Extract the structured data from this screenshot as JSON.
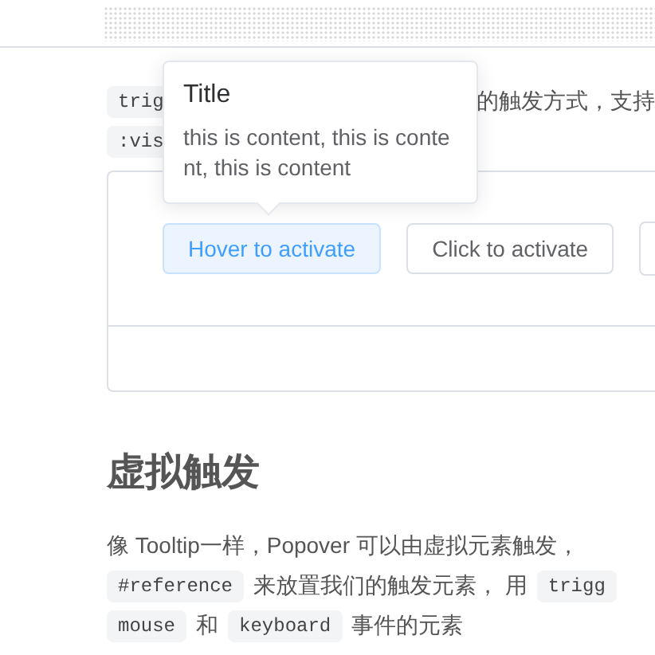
{
  "intro_lines": [
    [
      {
        "kind": "code",
        "text": "trig"
      },
      {
        "kind": "text",
        "text": "的触发方式，支持"
      }
    ],
    [
      {
        "kind": "code",
        "text": ":vis"
      }
    ]
  ],
  "popover": {
    "title": "Title",
    "content": "this is content, this is content, this is content"
  },
  "demo_buttons": [
    {
      "label": "Hover to activate",
      "selected": true
    },
    {
      "label": "Click to activate",
      "selected": false
    }
  ],
  "heading": "虚拟触发",
  "paragraph_lines": [
    [
      {
        "kind": "text",
        "text": "像 Tooltip一样，Popover 可以由虚拟元素触发，"
      }
    ],
    [
      {
        "kind": "code",
        "text": "#reference"
      },
      {
        "kind": "text",
        "text": "来放置我们的触发元素， 用"
      },
      {
        "kind": "code",
        "text": "trigg"
      }
    ],
    [
      {
        "kind": "code",
        "text": "mouse"
      },
      {
        "kind": "text",
        "text": "和"
      },
      {
        "kind": "code",
        "text": "keyboard"
      },
      {
        "kind": "text",
        "text": "事件的元素"
      }
    ]
  ]
}
